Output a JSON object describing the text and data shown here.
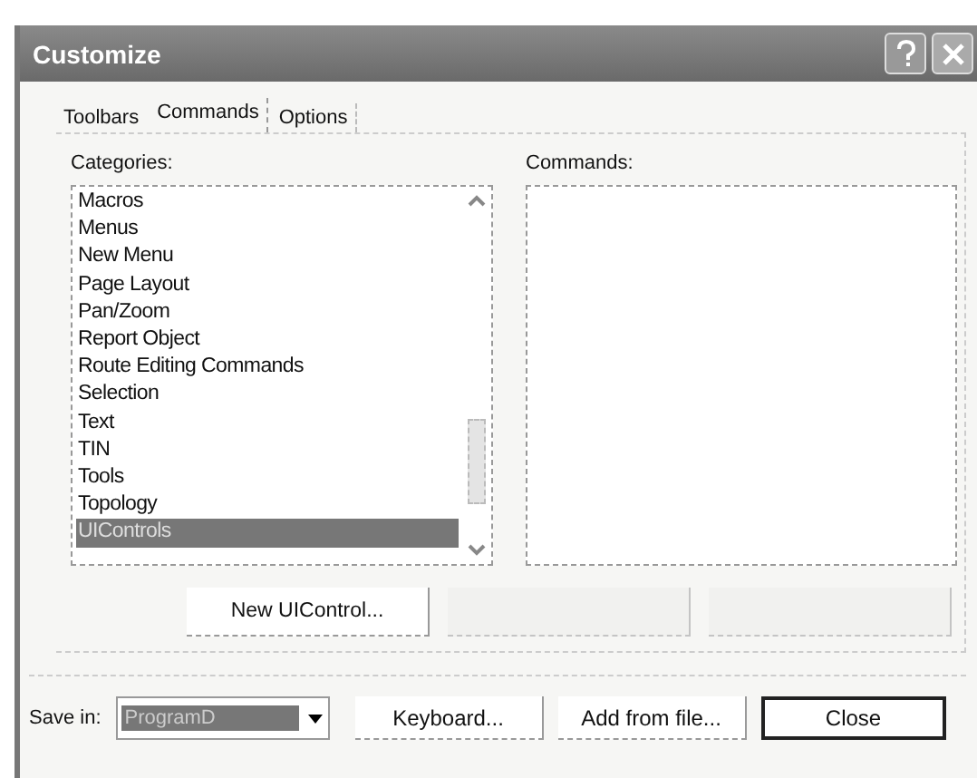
{
  "window": {
    "title": "Customize"
  },
  "tabs": [
    {
      "label": "Toolbars",
      "selected": false
    },
    {
      "label": "Commands",
      "selected": true
    },
    {
      "label": "Options",
      "selected": false
    }
  ],
  "categories": {
    "label": "Categories:",
    "items": [
      {
        "label": "Macros",
        "selected": false
      },
      {
        "label": "Menus",
        "selected": false
      },
      {
        "label": "New Menu",
        "selected": false
      },
      {
        "label": "Page Layout",
        "selected": false
      },
      {
        "label": "Pan/Zoom",
        "selected": false
      },
      {
        "label": "Report Object",
        "selected": false
      },
      {
        "label": "Route Editing Commands",
        "selected": false
      },
      {
        "label": "Selection",
        "selected": false
      },
      {
        "label": "Text",
        "selected": false
      },
      {
        "label": "TIN",
        "selected": false
      },
      {
        "label": "Tools",
        "selected": false
      },
      {
        "label": "Topology",
        "selected": false
      },
      {
        "label": "UIControls",
        "selected": true
      }
    ]
  },
  "commands": {
    "label": "Commands:"
  },
  "action_buttons": [
    {
      "label": "New UIControl...",
      "disabled": false
    },
    {
      "disabled": true
    },
    {
      "disabled": true
    }
  ],
  "save_in": {
    "label": "Save in:",
    "value": "ProgramD"
  },
  "footer_buttons": [
    {
      "label": "Keyboard...",
      "default": false
    },
    {
      "label": "Add from file...",
      "default": false
    },
    {
      "label": "Close",
      "default": true
    }
  ]
}
